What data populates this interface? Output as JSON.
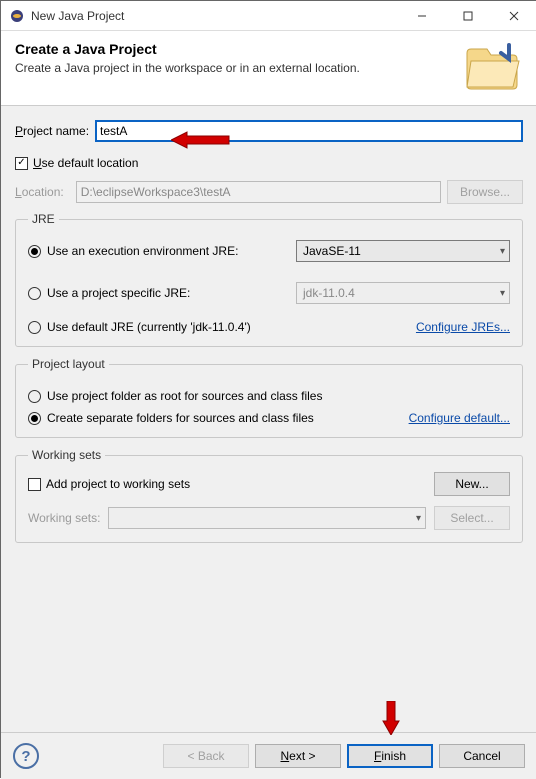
{
  "window": {
    "title": "New Java Project"
  },
  "banner": {
    "title": "Create a Java Project",
    "subtitle": "Create a Java project in the workspace or in an external location."
  },
  "project_name": {
    "label": "Project name:",
    "value": "testA"
  },
  "use_default_location": {
    "checked": true,
    "label": "Use default location"
  },
  "location": {
    "label": "Location:",
    "value": "D:\\eclipseWorkspace3\\testA",
    "browse": "Browse..."
  },
  "jre": {
    "legend": "JRE",
    "opt_exec_env": "Use an execution environment JRE:",
    "exec_env_value": "JavaSE-11",
    "opt_project_specific": "Use a project specific JRE:",
    "project_specific_value": "jdk-11.0.4",
    "opt_default": "Use default JRE (currently 'jdk-11.0.4')",
    "configure": "Configure JREs..."
  },
  "layout": {
    "legend": "Project layout",
    "opt_root": "Use project folder as root for sources and class files",
    "opt_separate": "Create separate folders for sources and class files",
    "configure": "Configure default..."
  },
  "working_sets": {
    "legend": "Working sets",
    "add_label": "Add project to working sets",
    "new_btn": "New...",
    "combo_label": "Working sets:",
    "select_btn": "Select..."
  },
  "buttons": {
    "back": "< Back",
    "next": "Next >",
    "finish": "Finish",
    "cancel": "Cancel"
  }
}
